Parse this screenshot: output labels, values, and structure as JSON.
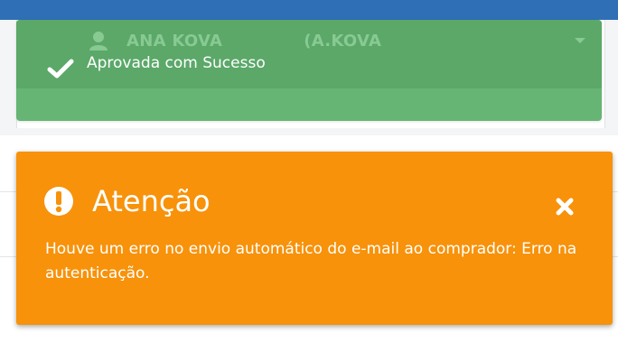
{
  "header": {
    "user_name": "ANA KOVA",
    "user_login": "(A.KOVA",
    "icon": "user-icon",
    "color": "#2f6fb6"
  },
  "success_toast": {
    "message": "Aprovada com Sucesso",
    "icon": "check-icon",
    "color": "#5cb06a"
  },
  "warning_toast": {
    "title": "Atenção",
    "message": "Houve um erro no envio automático do e-mail ao comprador: Erro na autenticação.",
    "title_icon": "exclamation-circle-icon",
    "close_icon": "close-icon",
    "color": "#f7920a"
  }
}
